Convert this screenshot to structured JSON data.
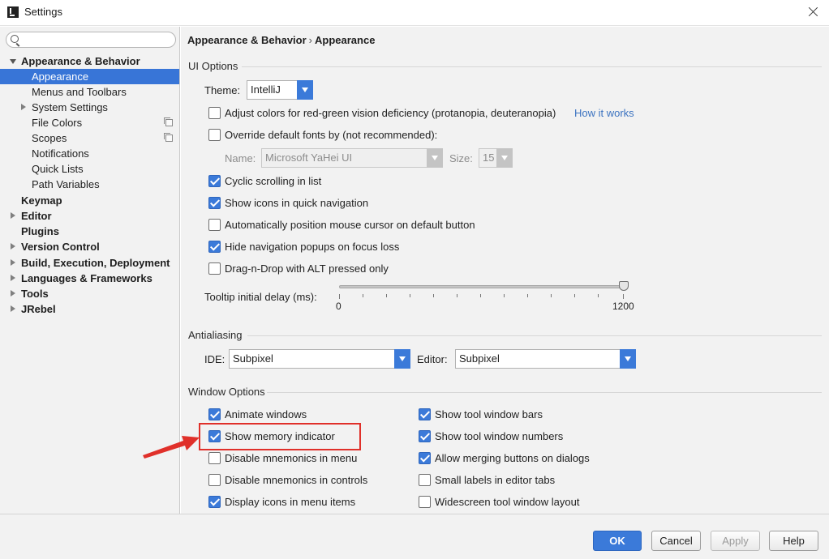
{
  "window": {
    "title": "Settings"
  },
  "sidebar": {
    "search_placeholder": "",
    "items": [
      {
        "label": "Appearance & Behavior"
      },
      {
        "label": "Appearance"
      },
      {
        "label": "Menus and Toolbars"
      },
      {
        "label": "System Settings"
      },
      {
        "label": "File Colors"
      },
      {
        "label": "Scopes"
      },
      {
        "label": "Notifications"
      },
      {
        "label": "Quick Lists"
      },
      {
        "label": "Path Variables"
      },
      {
        "label": "Keymap"
      },
      {
        "label": "Editor"
      },
      {
        "label": "Plugins"
      },
      {
        "label": "Version Control"
      },
      {
        "label": "Build, Execution, Deployment"
      },
      {
        "label": "Languages & Frameworks"
      },
      {
        "label": "Tools"
      },
      {
        "label": "JRebel"
      }
    ]
  },
  "breadcrumb": {
    "parent": "Appearance & Behavior",
    "separator": "›",
    "current": "Appearance"
  },
  "ui_options": {
    "section": "UI Options",
    "theme_label": "Theme:",
    "theme_value": "IntelliJ",
    "adjust_colors": {
      "label": "Adjust colors for red-green vision deficiency (protanopia, deuteranopia)",
      "checked": false
    },
    "how_it_works": "How it works",
    "override_fonts": {
      "label": "Override default fonts by (not recommended):",
      "checked": false
    },
    "name_label": "Name:",
    "name_value": "Microsoft YaHei UI",
    "size_label": "Size:",
    "size_value": "15",
    "cyclic_scrolling": {
      "label": "Cyclic scrolling in list",
      "checked": true
    },
    "show_icons_quick_nav": {
      "label": "Show icons in quick navigation",
      "checked": true
    },
    "auto_position_mouse": {
      "label": "Automatically position mouse cursor on default button",
      "checked": false
    },
    "hide_nav_popups": {
      "label": "Hide navigation popups on focus loss",
      "checked": true
    },
    "drag_n_drop": {
      "label": "Drag-n-Drop with ALT pressed only",
      "checked": false
    },
    "tooltip_label": "Tooltip initial delay (ms):",
    "tooltip_min": "0",
    "tooltip_max": "1200",
    "tooltip_value": 1200
  },
  "antialiasing": {
    "section": "Antialiasing",
    "ide_label": "IDE:",
    "ide_value": "Subpixel",
    "editor_label": "Editor:",
    "editor_value": "Subpixel"
  },
  "window_options": {
    "section": "Window Options",
    "animate_windows": {
      "label": "Animate windows",
      "checked": true
    },
    "show_memory_indicator": {
      "label": "Show memory indicator",
      "checked": true
    },
    "disable_mnemonics_menu": {
      "label": "Disable mnemonics in menu",
      "checked": false
    },
    "disable_mnemonics_controls": {
      "label": "Disable mnemonics in controls",
      "checked": false
    },
    "display_icons_menu": {
      "label": "Display icons in menu items",
      "checked": true
    },
    "show_tool_window_bars": {
      "label": "Show tool window bars",
      "checked": true
    },
    "show_tool_window_numbers": {
      "label": "Show tool window numbers",
      "checked": true
    },
    "allow_merging_buttons": {
      "label": "Allow merging buttons on dialogs",
      "checked": true
    },
    "small_labels_tabs": {
      "label": "Small labels in editor tabs",
      "checked": false
    },
    "widescreen_layout": {
      "label": "Widescreen tool window layout",
      "checked": false
    }
  },
  "footer": {
    "ok": "OK",
    "cancel": "Cancel",
    "apply": "Apply",
    "help": "Help"
  },
  "colors": {
    "accent": "#3b7ad9",
    "selection": "#3875d7",
    "highlight": "#e0302a",
    "link": "#3c73c0"
  }
}
